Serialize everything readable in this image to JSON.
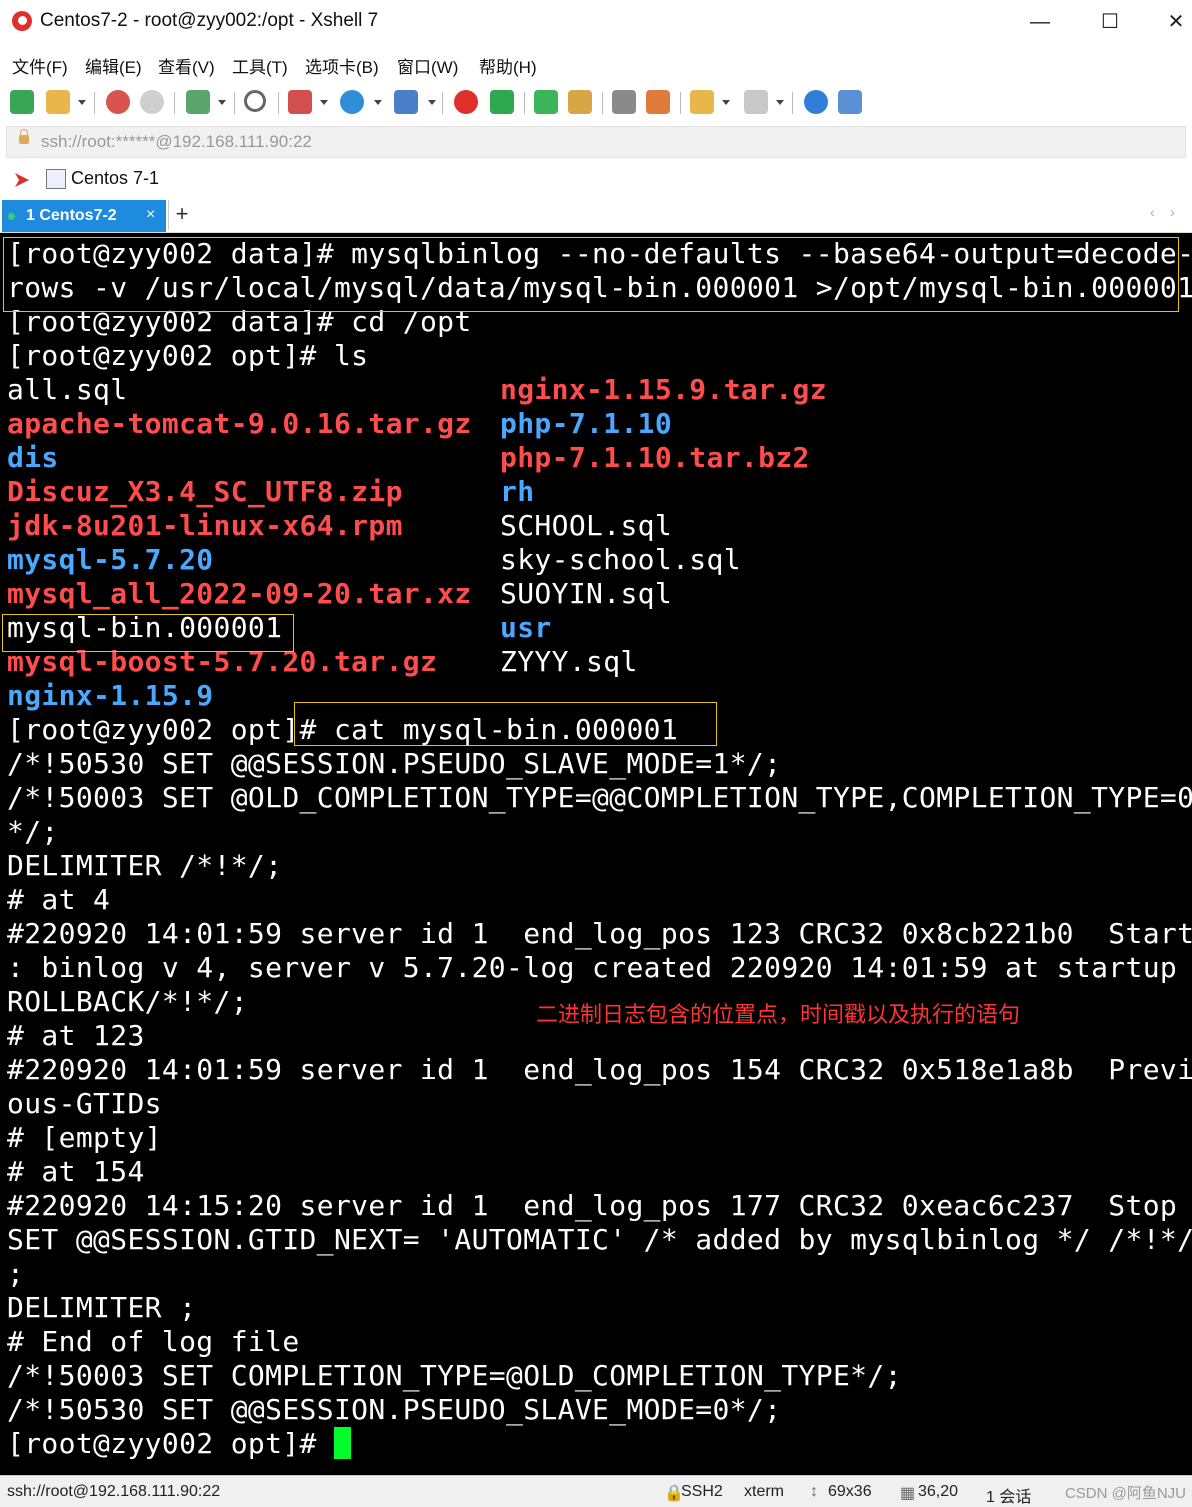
{
  "window": {
    "title": "Centos7-2 - root@zyy002:/opt - Xshell 7",
    "controls": {
      "minimize": "—",
      "maximize": "☐",
      "close": "✕"
    }
  },
  "menu": [
    "文件(F)",
    "编辑(E)",
    "查看(V)",
    "工具(T)",
    "选项卡(B)",
    "窗口(W)",
    "帮助(H)"
  ],
  "address": "ssh://root:******@192.168.111.90:22",
  "session_bar": {
    "session_label": "Centos 7-1"
  },
  "tabs": {
    "active_label": "1 Centos7-2",
    "close": "×",
    "add": "+"
  },
  "terminal": {
    "cmd1_line1": "[root@zyy002 data]# mysqlbinlog --no-defaults --base64-output=decode-",
    "cmd1_line2": "rows -v /usr/local/mysql/data/mysql-bin.000001 >/opt/mysql-bin.000001",
    "cmd2": "[root@zyy002 data]# cd /opt",
    "cmd3": "[root@zyy002 opt]# ls",
    "ls_left": [
      "all.sql",
      "apache-tomcat-9.0.16.tar.gz",
      "dis",
      "Discuz_X3.4_SC_UTF8.zip",
      "jdk-8u201-linux-x64.rpm",
      "mysql-5.7.20",
      "mysql_all_2022-09-20.tar.xz",
      "mysql-bin.000001",
      "mysql-boost-5.7.20.tar.gz",
      "nginx-1.15.9"
    ],
    "ls_right": [
      "nginx-1.15.9.tar.gz",
      "php-7.1.10",
      "php-7.1.10.tar.bz2",
      "rh",
      "SCHOOL.sql",
      "sky-school.sql",
      "SUOYIN.sql",
      "usr",
      "ZYYY.sql"
    ],
    "cmd4_prompt": "[root@zyy002 opt]",
    "cmd4_rest": "# cat mysql-bin.000001",
    "output": [
      "/*!50530 SET @@SESSION.PSEUDO_SLAVE_MODE=1*/;",
      "/*!50003 SET @OLD_COMPLETION_TYPE=@@COMPLETION_TYPE,COMPLETION_TYPE=0",
      "*/;",
      "DELIMITER /*!*/;",
      "# at 4",
      "#220920 14:01:59 server id 1  end_log_pos 123 CRC32 0x8cb221b0  Start",
      ": binlog v 4, server v 5.7.20-log created 220920 14:01:59 at startup",
      "ROLLBACK/*!*/;",
      "# at 123",
      "#220920 14:01:59 server id 1  end_log_pos 154 CRC32 0x518e1a8b  Previ",
      "ous-GTIDs",
      "# [empty]",
      "# at 154",
      "#220920 14:15:20 server id 1  end_log_pos 177 CRC32 0xeac6c237  Stop",
      "SET @@SESSION.GTID_NEXT= 'AUTOMATIC' /* added by mysqlbinlog */ /*!*/",
      ";",
      "DELIMITER ;",
      "# End of log file",
      "/*!50003 SET COMPLETION_TYPE=@OLD_COMPLETION_TYPE*/;",
      "/*!50530 SET @@SESSION.PSEUDO_SLAVE_MODE=0*/;"
    ],
    "final_prompt": "[root@zyy002 opt]# ",
    "annotation": "二进制日志包含的位置点，时间戳以及执行的语句"
  },
  "colors": {
    "terminal_bg": "#000000",
    "text": "#ffffff",
    "archive_red": "#ff4d4d",
    "dir_blue": "#4aa8ff",
    "cursor": "#00ff2a",
    "highlight": "#e4c900",
    "tab_active": "#1e8bde"
  },
  "status": {
    "connection": "ssh://root@192.168.111.90:22",
    "protocol": "SSH2",
    "term": "xterm",
    "size": "69x36",
    "cursor_pos": "36,20",
    "sessions": "1 会话",
    "watermark": "CSDN @阿鱼NJU"
  }
}
